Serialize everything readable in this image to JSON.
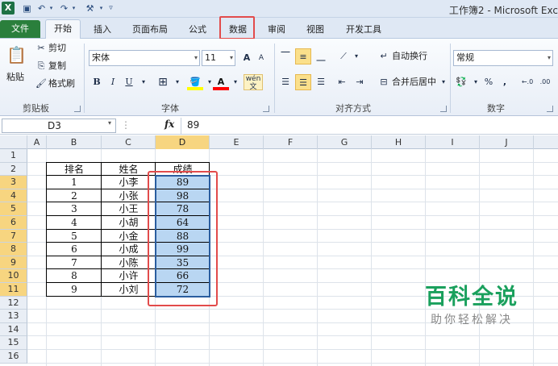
{
  "window": {
    "title": "工作簿2 - Microsoft Exc"
  },
  "tabs": [
    "文件",
    "开始",
    "插入",
    "页面布局",
    "公式",
    "数据",
    "审阅",
    "视图",
    "开发工具"
  ],
  "clipboard": {
    "paste": "粘贴",
    "cut": "剪切",
    "copy": "复制",
    "format_painter": "格式刷",
    "label": "剪贴板"
  },
  "font": {
    "name": "宋体",
    "size": "11",
    "bold": "B",
    "italic": "I",
    "underline": "U",
    "label": "字体",
    "grow": "A",
    "shrink": "A",
    "fill_color": "#ffff00",
    "font_color": "#ff0000",
    "wen": "wén\n文"
  },
  "alignment": {
    "wrap": "自动换行",
    "merge": "合并后居中",
    "label": "对齐方式"
  },
  "number": {
    "format": "常规",
    "percent": "%",
    "comma": ",",
    "label": "数字"
  },
  "formula_bar": {
    "name": "D3",
    "fx": "fx",
    "value": "89"
  },
  "columns": [
    "A",
    "B",
    "C",
    "D",
    "E",
    "F",
    "G",
    "H",
    "I",
    "J"
  ],
  "rows": [
    "1",
    "2",
    "3",
    "4",
    "5",
    "6",
    "7",
    "8",
    "9",
    "10",
    "11",
    "12",
    "13",
    "14",
    "15",
    "16"
  ],
  "table": {
    "headers": [
      "排名",
      "姓名",
      "成绩"
    ],
    "rows": [
      [
        "1",
        "小李",
        "89"
      ],
      [
        "2",
        "小张",
        "98"
      ],
      [
        "3",
        "小王",
        "78"
      ],
      [
        "4",
        "小胡",
        "64"
      ],
      [
        "5",
        "小金",
        "88"
      ],
      [
        "6",
        "小成",
        "99"
      ],
      [
        "7",
        "小陈",
        "35"
      ],
      [
        "8",
        "小许",
        "66"
      ],
      [
        "9",
        "小刘",
        "72"
      ]
    ]
  },
  "watermark": {
    "title": "百科全说",
    "subtitle": "助你轻松解决"
  },
  "colors": {
    "accent": "#2a7f3c",
    "highlight": "#e24b4b",
    "selection": "#b9d6f2"
  }
}
